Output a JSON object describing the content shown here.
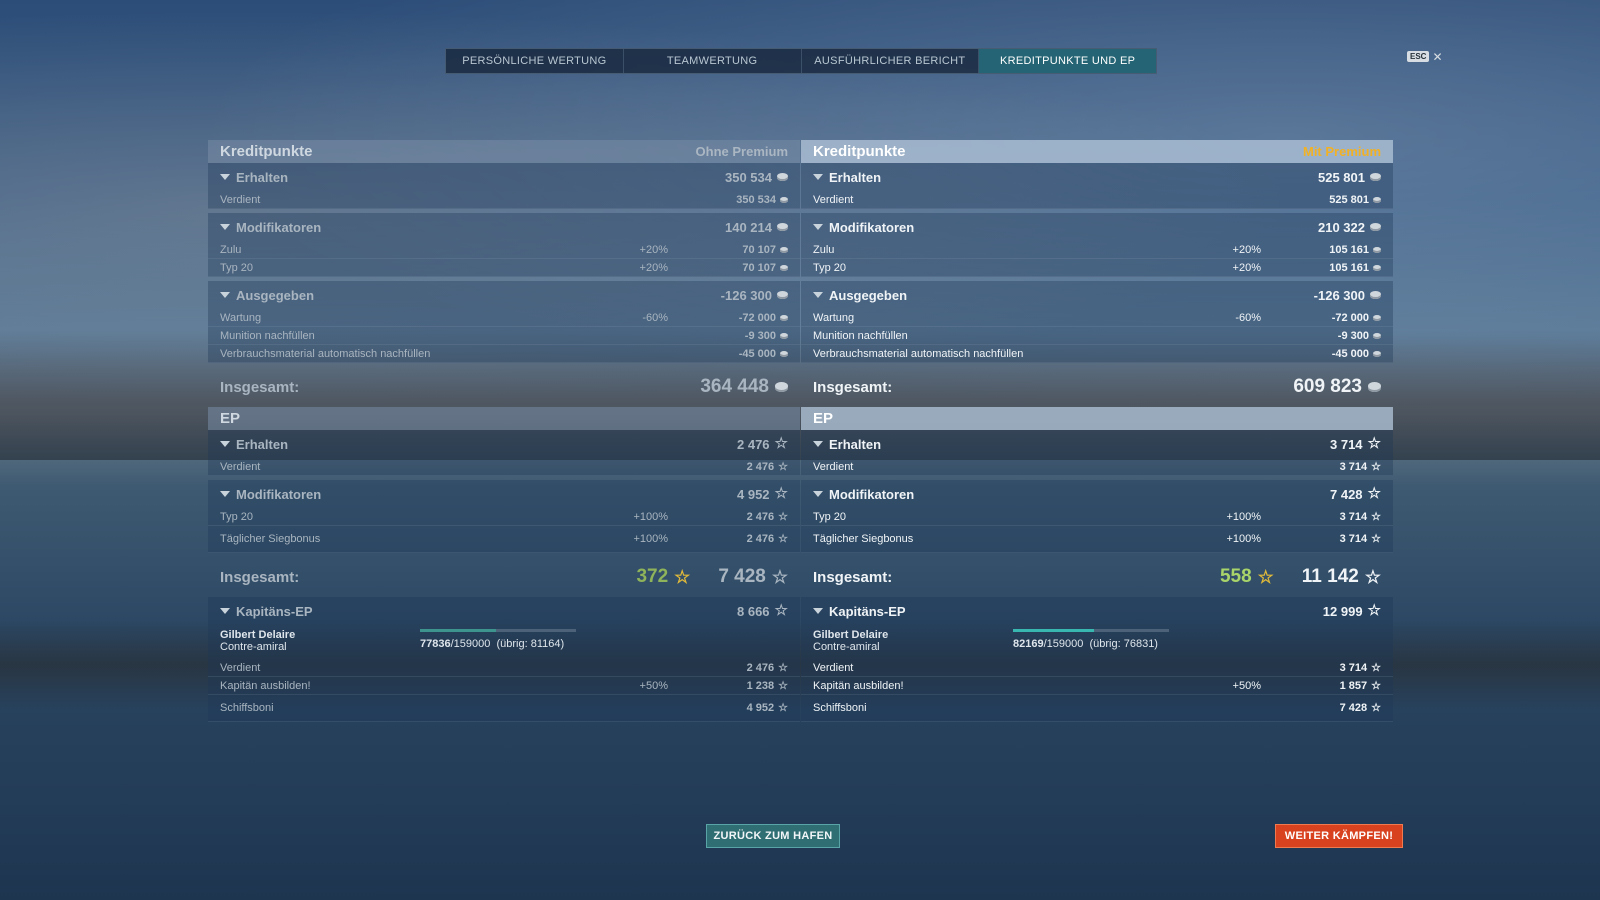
{
  "tabs": [
    {
      "label": "PERSÖNLICHE WERTUNG",
      "active": false
    },
    {
      "label": "TEAMWERTUNG",
      "active": false
    },
    {
      "label": "AUSFÜHRLICHER BERICHT",
      "active": false
    },
    {
      "label": "KREDITPUNKTE UND EP",
      "active": true
    }
  ],
  "esc_label": "ESC",
  "icons": {
    "credits": "credit-coin-icon",
    "xp": "star-icon",
    "collapse": "caret-down-icon",
    "close": "close-icon"
  },
  "colors": {
    "accent_premium": "#f2b124",
    "button_port": "#2f6f73",
    "button_fight": "#d8421e",
    "free_xp": "#a9d46a"
  },
  "left": {
    "credits_title": "Kreditpunkte",
    "credits_variant": "Ohne Premium",
    "received": {
      "label": "Erhalten",
      "value": "350 534",
      "rows": [
        {
          "label": "Verdient",
          "pct": "",
          "value": "350 534"
        }
      ]
    },
    "modifiers": {
      "label": "Modifikatoren",
      "value": "140 214",
      "rows": [
        {
          "label": "Zulu",
          "pct": "+20%",
          "value": "70 107"
        },
        {
          "label": "Typ 20",
          "pct": "+20%",
          "value": "70 107"
        }
      ]
    },
    "spent": {
      "label": "Ausgegeben",
      "value": "-126 300",
      "rows": [
        {
          "label": "Wartung",
          "pct": "-60%",
          "value": "-72 000"
        },
        {
          "label": "Munition nachfüllen",
          "pct": "",
          "value": "-9 300"
        },
        {
          "label": "Verbrauchsmaterial automatisch nachfüllen",
          "pct": "",
          "value": "-45 000"
        }
      ]
    },
    "credits_total_label": "Insgesamt:",
    "credits_total": "364 448",
    "xp_title": "EP",
    "xp_received": {
      "label": "Erhalten",
      "value": "2 476",
      "rows": [
        {
          "label": "Verdient",
          "pct": "",
          "value": "2 476"
        }
      ]
    },
    "xp_modifiers": {
      "label": "Modifikatoren",
      "value": "4 952",
      "rows": [
        {
          "label": "Typ 20",
          "pct": "+100%",
          "value": "2 476"
        },
        {
          "label": "Täglicher Siegbonus",
          "pct": "+100%",
          "value": "2 476"
        }
      ]
    },
    "xp_total_label": "Insgesamt:",
    "xp_free": "372",
    "xp_total": "7 428",
    "captain": {
      "section_label": "Kapitäns-EP",
      "value": "8 666",
      "name": "Gilbert Delaire",
      "rank": "Contre-amiral",
      "progress_current": "77836",
      "progress_max": "/159000",
      "progress_remaining": "(übrig: 81164)",
      "progress_fraction": 0.49,
      "rows": [
        {
          "label": "Verdient",
          "pct": "",
          "value": "2 476"
        },
        {
          "label": "Kapitän ausbilden!",
          "pct": "+50%",
          "value": "1 238"
        },
        {
          "label": "Schiffsboni",
          "pct": "",
          "value": "4 952"
        }
      ]
    }
  },
  "right": {
    "credits_title": "Kreditpunkte",
    "credits_variant": "Mit Premium",
    "received": {
      "label": "Erhalten",
      "value": "525 801",
      "rows": [
        {
          "label": "Verdient",
          "pct": "",
          "value": "525 801"
        }
      ]
    },
    "modifiers": {
      "label": "Modifikatoren",
      "value": "210 322",
      "rows": [
        {
          "label": "Zulu",
          "pct": "+20%",
          "value": "105 161"
        },
        {
          "label": "Typ 20",
          "pct": "+20%",
          "value": "105 161"
        }
      ]
    },
    "spent": {
      "label": "Ausgegeben",
      "value": "-126 300",
      "rows": [
        {
          "label": "Wartung",
          "pct": "-60%",
          "value": "-72 000"
        },
        {
          "label": "Munition nachfüllen",
          "pct": "",
          "value": "-9 300"
        },
        {
          "label": "Verbrauchsmaterial automatisch nachfüllen",
          "pct": "",
          "value": "-45 000"
        }
      ]
    },
    "credits_total_label": "Insgesamt:",
    "credits_total": "609 823",
    "xp_title": "EP",
    "xp_received": {
      "label": "Erhalten",
      "value": "3 714",
      "rows": [
        {
          "label": "Verdient",
          "pct": "",
          "value": "3 714"
        }
      ]
    },
    "xp_modifiers": {
      "label": "Modifikatoren",
      "value": "7 428",
      "rows": [
        {
          "label": "Typ 20",
          "pct": "+100%",
          "value": "3 714"
        },
        {
          "label": "Täglicher Siegbonus",
          "pct": "+100%",
          "value": "3 714"
        }
      ]
    },
    "xp_total_label": "Insgesamt:",
    "xp_free": "558",
    "xp_total": "11 142",
    "captain": {
      "section_label": "Kapitäns-EP",
      "value": "12 999",
      "name": "Gilbert Delaire",
      "rank": "Contre-amiral",
      "progress_current": "82169",
      "progress_max": "/159000",
      "progress_remaining": "(übrig: 76831)",
      "progress_fraction": 0.52,
      "rows": [
        {
          "label": "Verdient",
          "pct": "",
          "value": "3 714"
        },
        {
          "label": "Kapitän ausbilden!",
          "pct": "+50%",
          "value": "1 857"
        },
        {
          "label": "Schiffsboni",
          "pct": "",
          "value": "7 428"
        }
      ]
    }
  },
  "buttons": {
    "back_to_port": "ZURÜCK ZUM HAFEN",
    "keep_fighting": "WEITER KÄMPFEN!"
  }
}
